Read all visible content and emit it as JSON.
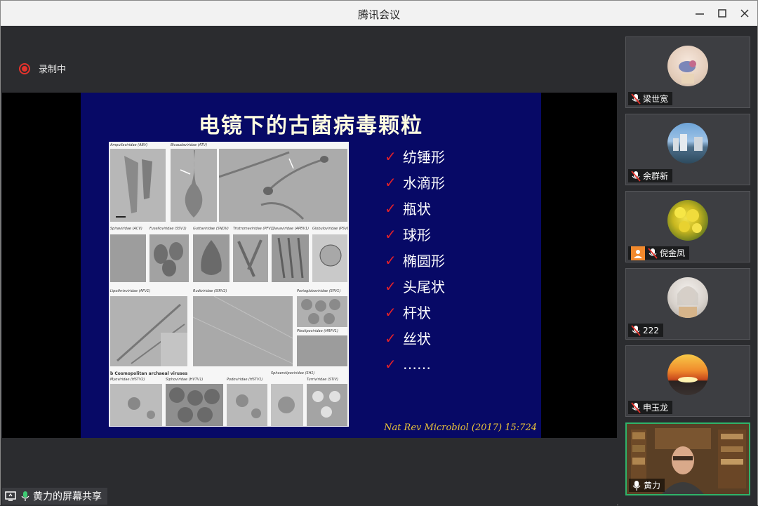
{
  "window": {
    "title": "腾讯会议"
  },
  "recording": {
    "label": "录制中"
  },
  "slide": {
    "title": "电镜下的古菌病毒颗粒",
    "shapes": [
      "纺锤形",
      "水滴形",
      "瓶状",
      "球形",
      "椭圆形",
      "头尾状",
      "杆状",
      "丝状",
      "……"
    ],
    "citation": "Nat Rev Microbiol (2017) 15:724",
    "figure_captions": {
      "ampulla": "Ampullaviridae (ABV)",
      "bicauda": "Bicaudaviridae (ATV)",
      "spira": "Spiraviridae (ACV)",
      "fusello": "Fuselloviridae (SSV1)",
      "gutta": "Guttaviridae (SNDV)",
      "tristroma": "Tristromaviridae (PFV1)",
      "clava": "Clavaviridae (APBV1)",
      "globulo": "Globuloviridae (PSV)",
      "lipothrix": "Lipothrixviridae (AFV1)",
      "rudi": "Rudiviridae (SIRV2)",
      "portoglobo": "Portogloboviridae (SPV1)",
      "pleolipo": "Pleolipoviridae (HRPV1)",
      "section_b": "b  Cosmopolitan archaeal viruses",
      "myo": "Myoviridae (HSTV2)",
      "sipho": "Siphoviridae (HVTV1)",
      "podo": "Podoviridae (HSTV1)",
      "sphaerolipo": "Sphaerolipoviridae (SH1)",
      "turri": "Turriviridae (STIV)"
    }
  },
  "screen_share": {
    "label": "黄力的屏幕共享"
  },
  "participants": [
    {
      "name": "梁世宽",
      "muted": true,
      "host": false
    },
    {
      "name": "余群新",
      "muted": true,
      "host": false
    },
    {
      "name": "倪金凤",
      "muted": true,
      "host": true
    },
    {
      "name": "222",
      "muted": true,
      "host": false
    },
    {
      "name": "申玉龙",
      "muted": true,
      "host": false
    },
    {
      "name": "黄力",
      "muted": false,
      "host": false,
      "speaking": true
    }
  ],
  "colors": {
    "accent_green": "#2fb36a",
    "record_red": "#e3332c",
    "slide_bg": "#070966",
    "check_red": "#e0202a",
    "citation_gold": "#e9c33a"
  }
}
